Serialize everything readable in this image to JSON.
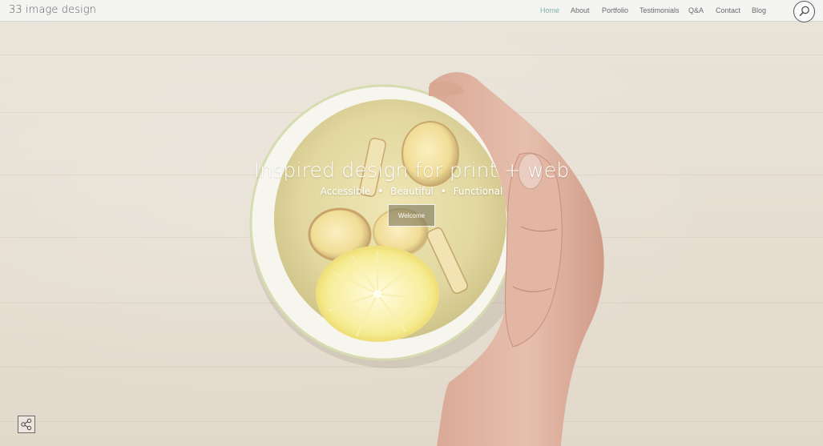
{
  "header": {
    "site_title": "33 image design",
    "nav": [
      {
        "label": "Home",
        "active": true
      },
      {
        "label": "About",
        "active": false
      },
      {
        "label": "Portfolio",
        "active": false
      },
      {
        "label": "Testimonials",
        "active": false
      },
      {
        "label": "Q&A",
        "active": false
      },
      {
        "label": "Contact",
        "active": false
      },
      {
        "label": "Blog",
        "active": false
      }
    ],
    "search_icon": "search-icon"
  },
  "hero": {
    "headline": "Inspired design for print + web",
    "features": [
      "Accessible",
      "Beautiful",
      "Functional"
    ],
    "separator": "•",
    "cta_label": "Welcome",
    "background_image": "bowl-of-ginger-lemon-tea-held-by-hand"
  },
  "share": {
    "icon": "share-icon"
  },
  "colors": {
    "nav_active": "#7fb5a5",
    "header_bg": "#f4f4f3",
    "hero_bg": "#e7e0d4"
  }
}
